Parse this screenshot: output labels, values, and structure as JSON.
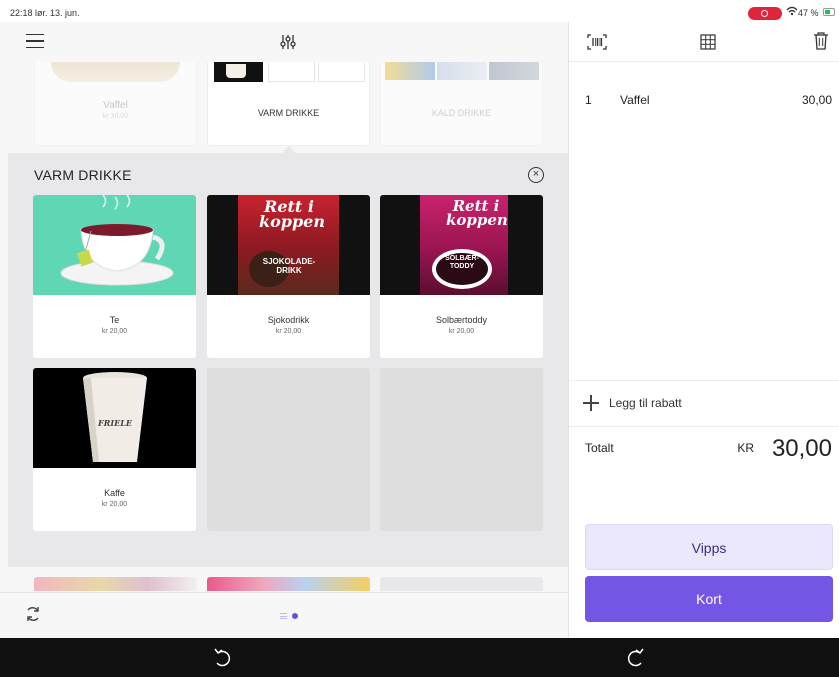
{
  "status_bar": {
    "time": "22:18",
    "date": "lør. 13. jun.",
    "battery": "47 %"
  },
  "left": {
    "menu_icon": "menu-icon",
    "filter_icon": "sliders-icon",
    "top_categories": [
      {
        "name": "Vaffel",
        "price": "kr 30,00"
      },
      {
        "name": "VARM DRIKKE"
      },
      {
        "name": "KALD DRIKKE"
      }
    ],
    "panel": {
      "title": "VARM DRIKKE",
      "close_glyph": "×",
      "products": [
        {
          "name": "Te",
          "price": "kr 20,00"
        },
        {
          "name": "Sjokodrikk",
          "price": "kr 20,00"
        },
        {
          "name": "Solbærtoddy",
          "price": "kr 20,00"
        },
        {
          "name": "Kaffe",
          "price": "kr 20,00"
        }
      ],
      "package_text": {
        "rett": "Rett i",
        "koppen": "koppen",
        "sjokolade": "SJOKOLADE-",
        "drikk": "DRIKK",
        "solbaer": "SOLBÆR-",
        "toddy": "TODDY",
        "friele": "FRIELE"
      }
    },
    "footer": {
      "sync_icon": "sync-icon"
    }
  },
  "right": {
    "header_icons": [
      "barcode-scan-icon",
      "grid-icon",
      "trash-icon"
    ],
    "order_lines": [
      {
        "qty": "1",
        "name": "Vaffel",
        "price": "30,00"
      }
    ],
    "discount_label": "Legg til rabatt",
    "total": {
      "label": "Totalt",
      "currency": "KR",
      "amount": "30,00"
    },
    "buttons": {
      "vipps": "Vipps",
      "kort": "Kort"
    }
  },
  "colors": {
    "accent": "#7356e3",
    "accent_light": "#ece8fb",
    "panel_bg": "#e8e8ea",
    "tea_bg": "#5fd6b4",
    "record_red": "#e0243a"
  }
}
